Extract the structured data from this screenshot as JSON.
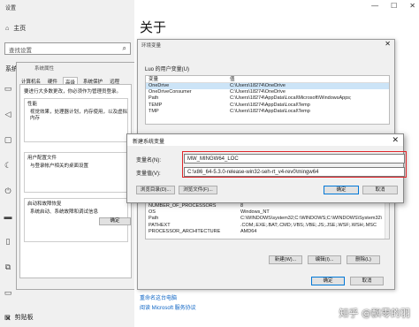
{
  "settings": {
    "window_title": "设置",
    "home": "主页",
    "search_placeholder": "查找设置",
    "system_label": "系统",
    "clipboard": "剪贴板"
  },
  "sysprops": {
    "title": "系统属性",
    "tabs": [
      "计算机名",
      "硬件",
      "高级",
      "系统保护",
      "远程"
    ],
    "admin_note": "要进行大多数更改，你必须作为管理员登录。",
    "perf_title": "性能",
    "perf_desc": "视觉效果，处理器计划，内存使用，以及虚拟内存",
    "profile_title": "用户配置文件",
    "profile_desc": "与登录帐户相关的桌面设置",
    "startup_title": "启动和故障恢复",
    "startup_desc": "系统启动、系统故障和调试信息",
    "ok": "确定"
  },
  "about": {
    "heading": "关于",
    "link1": "重命名这台电脑",
    "link2": "阅读 Microsoft 服务协议"
  },
  "envdlg": {
    "title": "环境变量",
    "user_section": "Luo 的用户变量(U)",
    "col_var": "变量",
    "col_val": "值",
    "user_vars": [
      {
        "name": "OneDrive",
        "value": "C:\\Users\\18274\\OneDrive"
      },
      {
        "name": "OneDriveConsumer",
        "value": "C:\\Users\\18274\\OneDrive"
      },
      {
        "name": "Path",
        "value": "C:\\Users\\18274\\AppData\\Local\\Microsoft\\WindowsApps;"
      },
      {
        "name": "TEMP",
        "value": "C:\\Users\\18274\\AppData\\Local\\Temp"
      },
      {
        "name": "TMP",
        "value": "C:\\Users\\18274\\AppData\\Local\\Temp"
      }
    ],
    "sys_vars": [
      {
        "name": "NUMBER_OF_PROCESSORS",
        "value": "8"
      },
      {
        "name": "OS",
        "value": "Windows_NT"
      },
      {
        "name": "Path",
        "value": "C:\\WINDOWS\\system32;C:\\WINDOWS;C:\\WINDOWS\\System32\\"
      },
      {
        "name": "PATHEXT",
        "value": ".COM;.EXE;.BAT;.CMD;.VBS;.VBE;.JS;.JSE;.WSF;.WSH;.MSC"
      },
      {
        "name": "PROCESSOR_ARCHITECTURE",
        "value": "AMD64"
      }
    ],
    "new_button": "新建(W)...",
    "edit_button": "编辑(I)...",
    "delete_button": "删除(L)",
    "ok": "确定",
    "cancel": "取消"
  },
  "newvar": {
    "title": "新建系统变量",
    "name_label": "变量名(N):",
    "name_value": "MW_MINGW64_LOC",
    "value_label": "变量值(V):",
    "value_value": "C:\\x86_64-5.3.0-release-win32-seh-rt_v4-rev0\\mingw64",
    "browse_dir": "浏览目录(D)...",
    "browse_file": "浏览文件(F)...",
    "ok": "确定",
    "cancel": "取消"
  },
  "watermark": "知乎 @飘零的羽"
}
